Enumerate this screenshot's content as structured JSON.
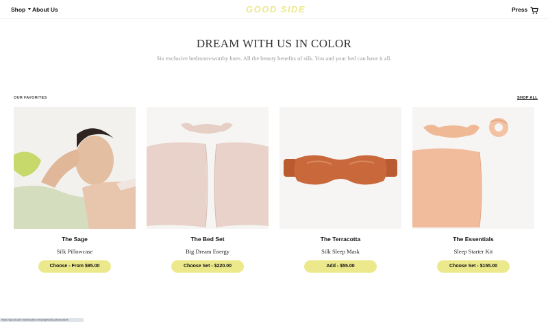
{
  "nav": {
    "shop_label": "Shop",
    "about_label": "About Us",
    "logo_text": "GOOD SIDE",
    "press_label": "Press",
    "cart_icon": "cart-icon"
  },
  "hero": {
    "title": "DREAM WITH US IN COLOR",
    "subtitle": "Six exclusive bedroom-worthy hues. All the beauty benefits of silk. You and your bed can have it all."
  },
  "favorites": {
    "label": "OUR FAVORITES",
    "shop_all_label": "SHOP ALL",
    "products": [
      {
        "name": "The Sage",
        "subtitle": "Silk Pillowcase",
        "button": "Choose - From $95.00"
      },
      {
        "name": "The Bed Set",
        "subtitle": "Big Dream Energy",
        "button": "Choose Set - $220.00"
      },
      {
        "name": "The Terracotta",
        "subtitle": "Silk Sleep Mask",
        "button": "Add - $55.00"
      },
      {
        "name": "The Essentials",
        "subtitle": "Sleep Starter Kit",
        "button": "Choose Set - $155.00"
      }
    ]
  },
  "status_bar": {
    "url": "https://good-side.myshopify.com/pages/silk-pillowcases"
  },
  "colors": {
    "accent": "#ece98d",
    "sage": "#c9d5b1",
    "blush": "#e8d0c6",
    "terracotta": "#c8683b",
    "peach": "#f1bc9c"
  }
}
